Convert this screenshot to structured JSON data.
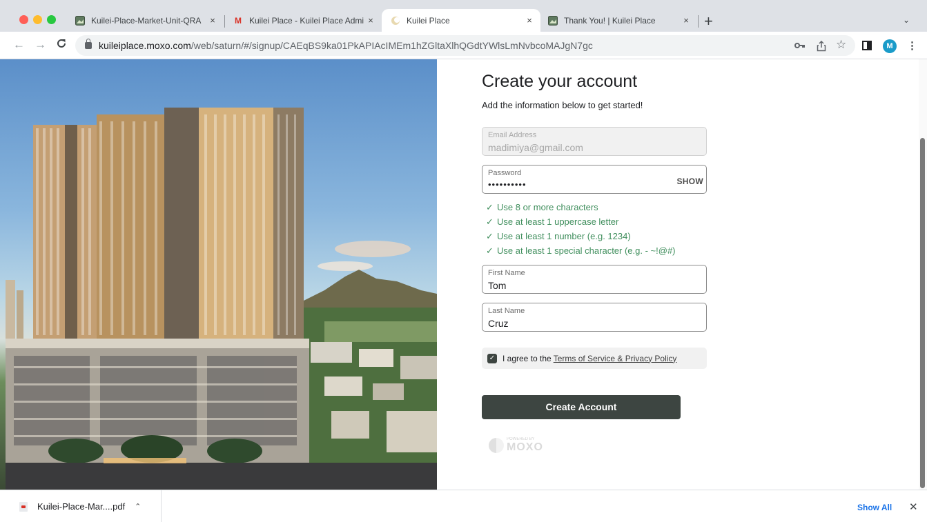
{
  "tabs": [
    {
      "title": "Kuilei-Place-Market-Unit-QRA",
      "favicon": "image-icon"
    },
    {
      "title": "Kuilei Place - Kuilei Place Admi",
      "favicon": "gmail-icon"
    },
    {
      "title": "Kuilei Place",
      "favicon": "moxo-icon"
    },
    {
      "title": "Thank You! | Kuilei Place",
      "favicon": "image-icon"
    }
  ],
  "tab_close": "×",
  "new_tab": "+",
  "tab_menu": "⌄",
  "url": {
    "host": "kuileiplace.moxo.com",
    "path": "/web/saturn/#/signup/CAEqBS9ka01PkAPIAcIMEm1hZGltaXlhQGdtYWlsLmNvbcoMAJgN7gc"
  },
  "avatar_letter": "M",
  "form": {
    "title": "Create your account",
    "subtitle": "Add the information below to get started!",
    "email": {
      "label": "Email Address",
      "value": "madimiya@gmail.com"
    },
    "password": {
      "label": "Password",
      "value": "••••••••••",
      "toggle": "SHOW"
    },
    "rules": [
      "Use 8 or more characters",
      "Use at least 1 uppercase letter",
      "Use at least 1 number (e.g. 1234)",
      "Use at least 1 special character (e.g. - ~!@#)"
    ],
    "first_name": {
      "label": "First Name",
      "value": "Tom"
    },
    "last_name": {
      "label": "Last Name",
      "value": "Cruz"
    },
    "agree_text": "I agree to the",
    "agree_link": "Terms of Service & Privacy Policy",
    "agree_checked": true,
    "submit": "Create Account",
    "powered_by": "POWERED BY",
    "brand": "MOXO"
  },
  "download": {
    "filename": "Kuilei-Place-Mar....pdf",
    "show_all": "Show All"
  },
  "colors": {
    "accent": "#3d4541",
    "rule_ok": "#3f8e5c",
    "link_blue": "#1a73e8"
  }
}
